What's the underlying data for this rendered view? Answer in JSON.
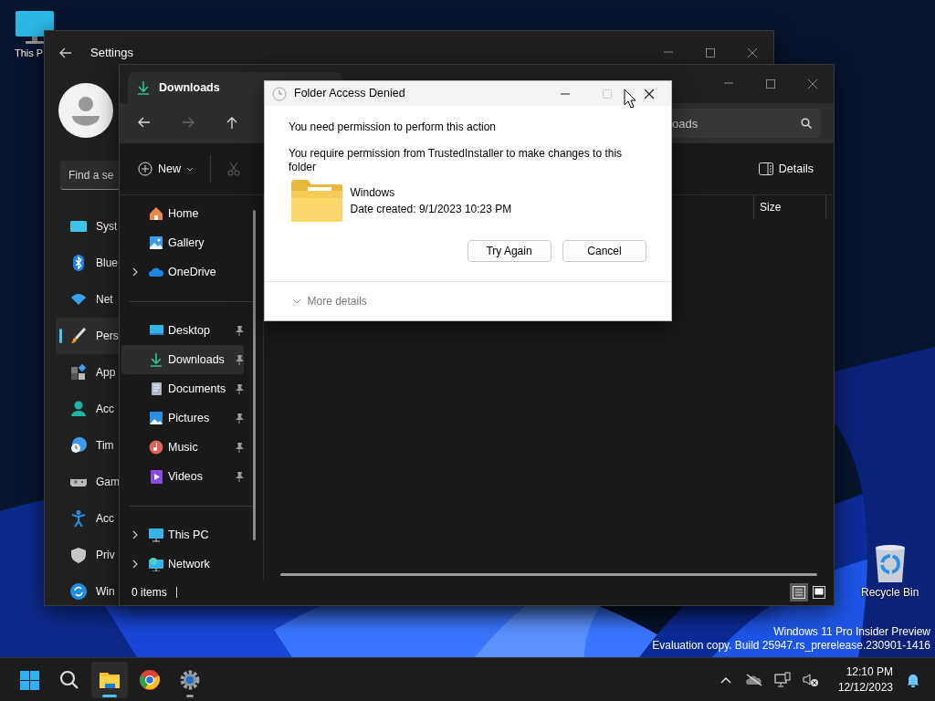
{
  "desktop_icons": [
    {
      "label": "This P"
    },
    {
      "label": "Recycle Bin"
    }
  ],
  "settings": {
    "title": "Settings",
    "search": {
      "placeholder": "Find a se"
    },
    "nav": [
      {
        "label": "Syst",
        "selected": false
      },
      {
        "label": "Blue",
        "selected": false
      },
      {
        "label": "Net",
        "selected": false
      },
      {
        "label": "Pers",
        "selected": true
      },
      {
        "label": "App",
        "selected": false
      },
      {
        "label": "Acc",
        "selected": false
      },
      {
        "label": "Tim",
        "selected": false
      },
      {
        "label": "Gam",
        "selected": false
      },
      {
        "label": "Acc",
        "selected": false
      },
      {
        "label": "Priv",
        "selected": false
      },
      {
        "label": "Win",
        "selected": false
      }
    ]
  },
  "explorer": {
    "tab": {
      "label": "Downloads",
      "selected": true
    },
    "search": {
      "value": "oads"
    },
    "toolbar": {
      "new": "New",
      "details": "Details"
    },
    "columns": [
      "Size"
    ],
    "sidebar": {
      "groups": [
        {
          "items": [
            {
              "label": "Home",
              "expandable": false,
              "pinned": false,
              "selected": false
            },
            {
              "label": "Gallery",
              "expandable": false,
              "pinned": false,
              "selected": false
            },
            {
              "label": "OneDrive",
              "expandable": true,
              "pinned": false,
              "selected": false
            }
          ]
        },
        {
          "items": [
            {
              "label": "Desktop",
              "expandable": false,
              "pinned": true,
              "selected": false
            },
            {
              "label": "Downloads",
              "expandable": false,
              "pinned": true,
              "selected": true
            },
            {
              "label": "Documents",
              "expandable": false,
              "pinned": true,
              "selected": false
            },
            {
              "label": "Pictures",
              "expandable": false,
              "pinned": true,
              "selected": false
            },
            {
              "label": "Music",
              "expandable": false,
              "pinned": true,
              "selected": false
            },
            {
              "label": "Videos",
              "expandable": false,
              "pinned": true,
              "selected": false
            }
          ]
        },
        {
          "items": [
            {
              "label": "This PC",
              "expandable": true,
              "pinned": false,
              "selected": false
            },
            {
              "label": "Network",
              "expandable": true,
              "pinned": false,
              "selected": false
            }
          ]
        }
      ]
    },
    "status": "0 items",
    "views": [
      {
        "selected": true
      },
      {
        "selected": false
      }
    ]
  },
  "dialog": {
    "title": "Folder Access Denied",
    "maximize_disabled": true,
    "heading": "You need permission to perform this action",
    "message": "You require permission from TrustedInstaller to make changes to this folder",
    "item": {
      "name": "Windows",
      "detail": "Date created: 9/1/2023 10:23 PM"
    },
    "buttons": [
      "Try Again",
      "Cancel"
    ],
    "more": "More details"
  },
  "watermark": [
    "Windows 11 Pro Insider Preview",
    "Evaluation copy. Build 25947.rs_prerelease.230901-1416"
  ],
  "taskbar": {
    "apps": [
      {
        "active": false,
        "running": false
      },
      {
        "active": false,
        "running": false
      },
      {
        "active": true,
        "running": true
      },
      {
        "active": false,
        "running": false
      },
      {
        "active": false,
        "running": true
      }
    ],
    "clock": {
      "time": "12:10 PM",
      "date": "12/12/2023"
    }
  }
}
